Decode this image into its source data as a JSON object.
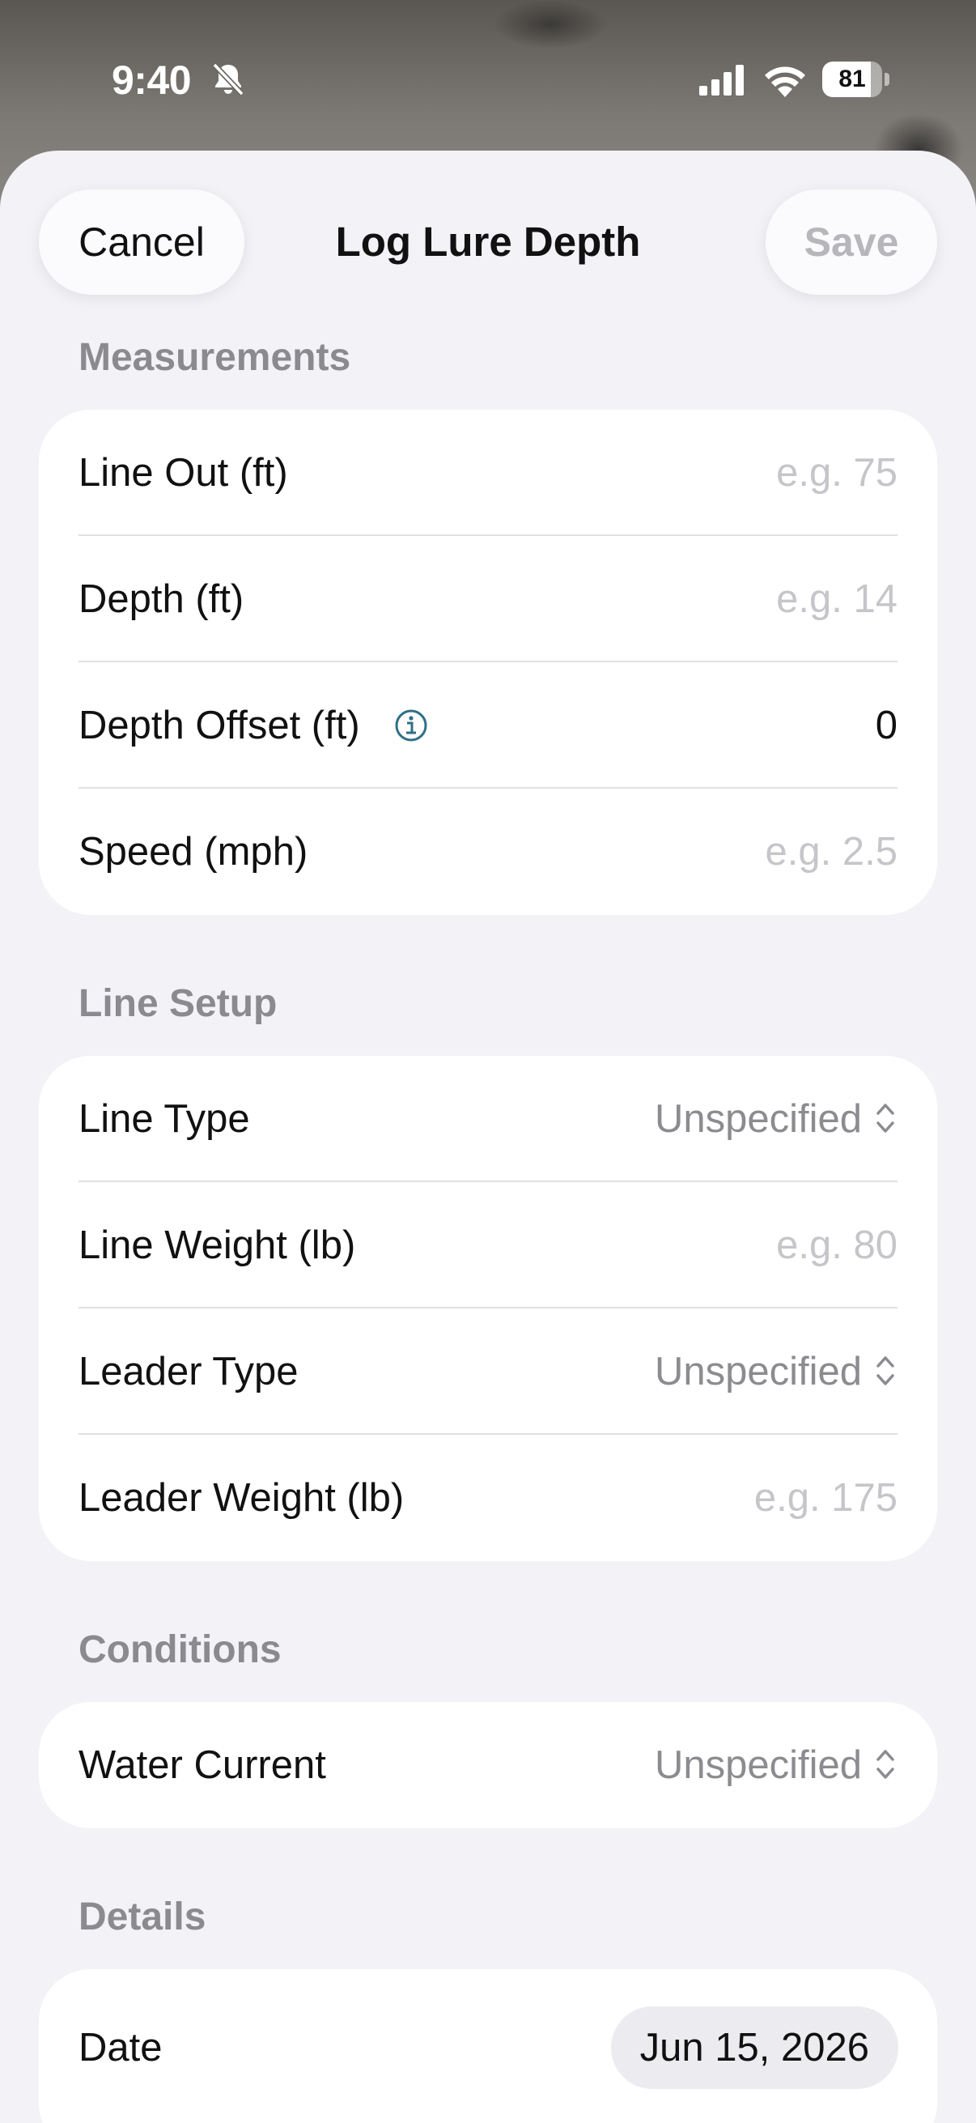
{
  "status_bar": {
    "time": "9:40",
    "battery_level": "81",
    "battery_fraction": 0.81
  },
  "nav": {
    "cancel_label": "Cancel",
    "title": "Log Lure Depth",
    "save_label": "Save"
  },
  "sections": {
    "measurements": {
      "header": "Measurements",
      "line_out": {
        "label": "Line Out (ft)",
        "placeholder": "e.g. 75"
      },
      "depth": {
        "label": "Depth (ft)",
        "placeholder": "e.g. 14"
      },
      "depth_offset": {
        "label": "Depth Offset (ft)",
        "value": "0"
      },
      "speed": {
        "label": "Speed (mph)",
        "placeholder": "e.g. 2.5"
      }
    },
    "line_setup": {
      "header": "Line Setup",
      "line_type": {
        "label": "Line Type",
        "value": "Unspecified"
      },
      "line_weight": {
        "label": "Line Weight (lb)",
        "placeholder": "e.g. 80"
      },
      "leader_type": {
        "label": "Leader Type",
        "value": "Unspecified"
      },
      "leader_weight": {
        "label": "Leader Weight (lb)",
        "placeholder": "e.g. 175"
      }
    },
    "conditions": {
      "header": "Conditions",
      "water_current": {
        "label": "Water Current",
        "value": "Unspecified"
      }
    },
    "details": {
      "header": "Details",
      "date": {
        "label": "Date",
        "value": "Jun 15, 2026"
      }
    }
  },
  "icons": {
    "bell": "bell-slash-icon",
    "signal": "cellular-signal-icon",
    "wifi": "wifi-icon",
    "info": "info-circle-icon",
    "chevron": "chevron-up-down-icon"
  },
  "colors": {
    "sheet_background": "#f2f2f7",
    "card_background": "#ffffff",
    "section_header": "#8a8a8f",
    "placeholder": "#c5c5ca",
    "info_accent": "#2f6f86"
  }
}
